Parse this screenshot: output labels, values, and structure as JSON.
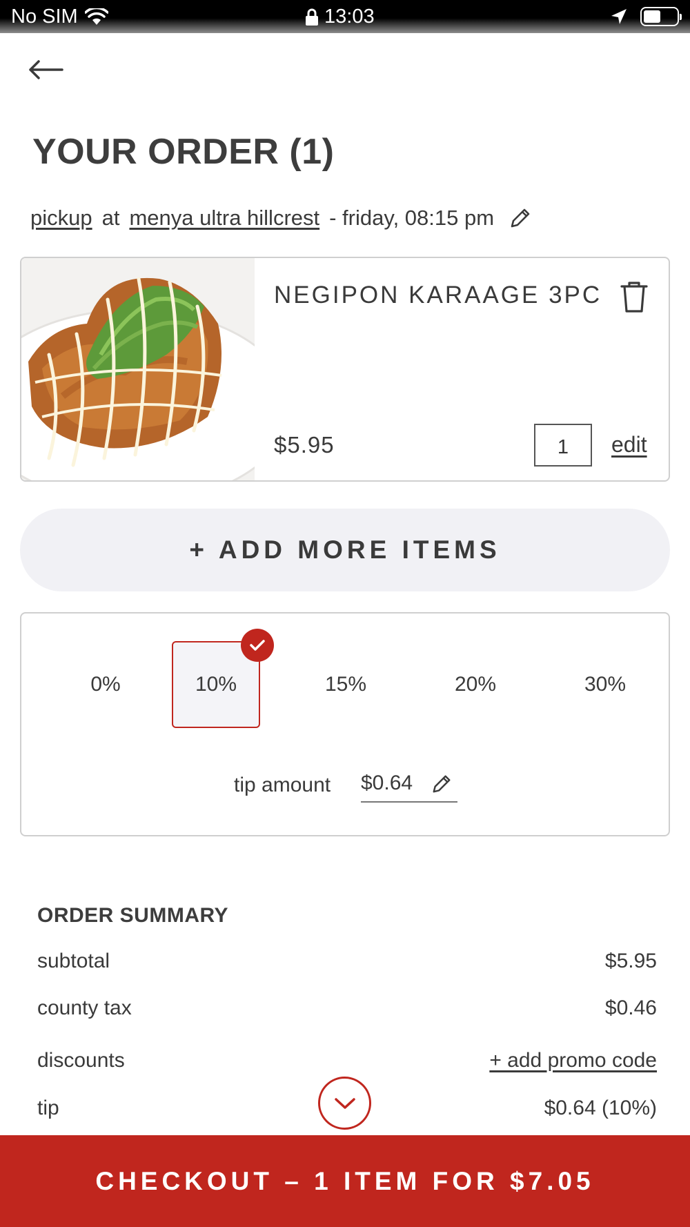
{
  "status_bar": {
    "carrier": "No SIM",
    "time": "13:03"
  },
  "header": {
    "title": "YOUR ORDER (1)"
  },
  "pickup": {
    "mode": "pickup",
    "at": "at",
    "location": "menya ultra hillcrest",
    "time": "- friday, 08:15 pm"
  },
  "item": {
    "name": "NEGIPON KARAAGE 3PC",
    "price": "$5.95",
    "quantity": "1",
    "edit_label": "edit"
  },
  "add_more_label": "+ ADD MORE ITEMS",
  "tip": {
    "options": [
      "0%",
      "10%",
      "15%",
      "20%",
      "30%"
    ],
    "selected": "10%",
    "amount_label": "tip amount",
    "amount_value": "$0.64"
  },
  "summary": {
    "title": "ORDER SUMMARY",
    "rows": [
      {
        "label": "subtotal",
        "value": "$5.95"
      },
      {
        "label": "county tax",
        "value": "$0.46"
      },
      {
        "label": "discounts",
        "value": "+ add promo code"
      },
      {
        "label": "tip",
        "value": "$0.64 (10%)"
      }
    ]
  },
  "checkout_label": "CHECKOUT – 1 ITEM FOR $7.05",
  "colors": {
    "accent": "#c0261e",
    "text": "#3a3a3a",
    "card_border": "#cfcfcf",
    "pill_bg": "#f1f1f5"
  }
}
